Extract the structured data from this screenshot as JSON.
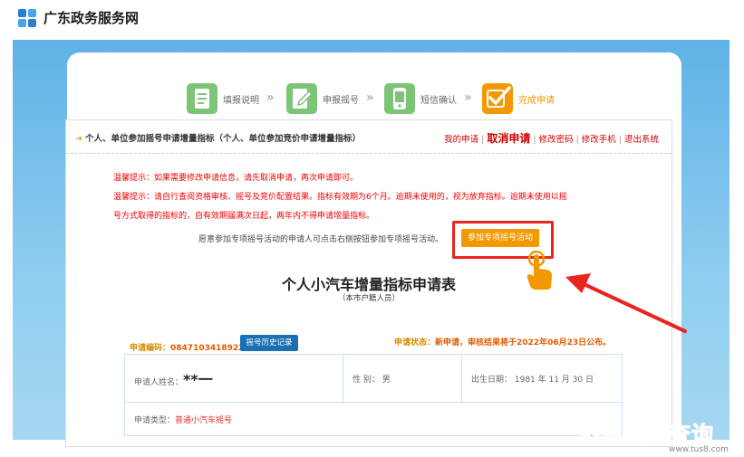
{
  "site": {
    "title": "广东政务服务网",
    "logo_icon": "guangdong-gov-logo"
  },
  "steps": [
    {
      "label": "填报说明",
      "icon": "form-doc-icon",
      "color": "#7cc576"
    },
    {
      "label": "申报摇号",
      "icon": "form-edit-icon",
      "color": "#7cc576"
    },
    {
      "label": "短信确认",
      "icon": "phone-icon",
      "color": "#7cc576"
    },
    {
      "label": "完成申请",
      "icon": "checkmark-icon",
      "color": "#f39800"
    }
  ],
  "panel": {
    "title": "个人、单位参加摇号申请增量指标（个人、单位参加竞价申请增量指标）",
    "links": {
      "my_app": "我的申请",
      "cancel": "取消申请",
      "change_pwd": "修改密码",
      "change_phone": "修改手机",
      "logout": "退出系统"
    }
  },
  "tips": [
    "温馨提示：如果需要修改申请信息，请先取消申请，再次申请即可。",
    "温馨提示：请自行查阅资格审核、摇号及竞价配置结果。指标有效期为6个月。逾期未使用的，视为放弃指标。逾期未使用以摇",
    "号方式取得的指标的，自有效期届满次日起，两年内不得申请增量指标。"
  ],
  "invite_text": "愿意参加专项摇号活动的申请人可点击右侧按钮参加专项摇号活动。",
  "join_button": "参加专项摇号活动",
  "form": {
    "title": "个人小汽车增量指标申请表",
    "subtitle": "（本市户籍人员）",
    "code_label": "申请编码：",
    "code_value": "0847103418922",
    "history_button": "摇号历史记录",
    "status_label": "申请状态：",
    "status_value": "新申请，审核结果将于2022年06月23日公布。",
    "name_label": "申请人姓名：",
    "name_value": "**一",
    "gender": "性 别： 男",
    "birth": "出生日期： 1981 年 11 月 30 日",
    "type_label": "申请类型：",
    "type_value": "普通小汽车摇号"
  },
  "watermark": {
    "text": "深圳地铁查询",
    "url": "www.tus8.com"
  },
  "colors": {
    "accent": "#f39800",
    "highlight": "#e8261f",
    "link": "#c00",
    "bg": "#5fb2e6"
  }
}
